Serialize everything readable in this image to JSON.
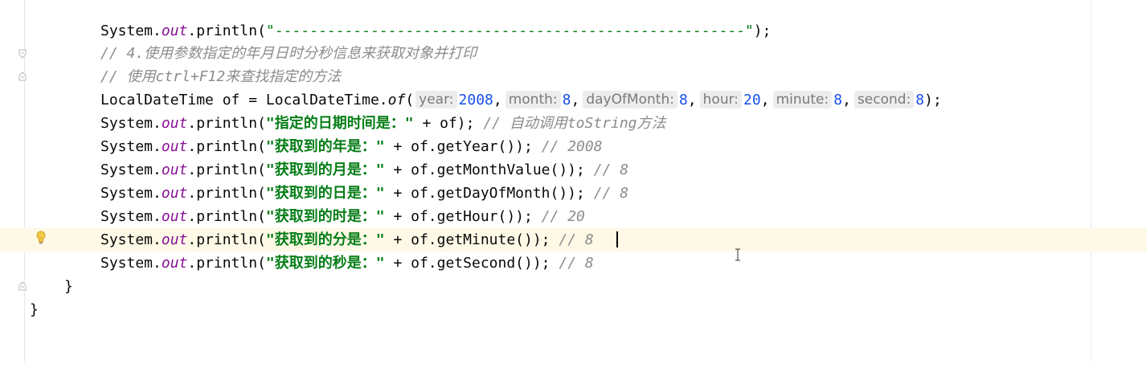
{
  "editor": {
    "lines": [
      {
        "id": "l1",
        "parts": [
          "System.",
          "out",
          ".println(",
          "\"------------------------------------------------------\"",
          ");"
        ]
      },
      {
        "id": "l2",
        "comment": "// 4.使用参数指定的年月日时分秒信息来获取对象并打印"
      },
      {
        "id": "l3",
        "comment": "// 使用ctrl+F12来查找指定的方法"
      },
      {
        "id": "l4",
        "prefix": "LocalDateTime of = LocalDateTime.",
        "method": "of",
        "open": "(",
        "params": [
          {
            "hint": "year:",
            "value": "2008"
          },
          {
            "hint": "month:",
            "value": "8"
          },
          {
            "hint": "dayOfMonth:",
            "value": "8"
          },
          {
            "hint": "hour:",
            "value": "20"
          },
          {
            "hint": "minute:",
            "value": "8"
          },
          {
            "hint": "second:",
            "value": "8"
          }
        ],
        "close": ");"
      },
      {
        "id": "l5",
        "str": "\"指定的日期时间是：\"",
        "rest": " + of); ",
        "comment": "// 自动调用toString方法"
      },
      {
        "id": "l6",
        "str": "\"获取到的年是：\"",
        "rest": " + of.getYear()); ",
        "comment": "// 2008"
      },
      {
        "id": "l7",
        "str": "\"获取到的月是：\"",
        "rest": " + of.getMonthValue()); ",
        "comment": "// 8"
      },
      {
        "id": "l8",
        "str": "\"获取到的日是：\"",
        "rest": " + of.getDayOfMonth()); ",
        "comment": "// 8"
      },
      {
        "id": "l9",
        "str": "\"获取到的时是：\"",
        "rest": " + of.getHour()); ",
        "comment": "// 20"
      },
      {
        "id": "l10",
        "str": "\"获取到的分是：\"",
        "rest": " + of.getMinute()); ",
        "comment": "// 8"
      },
      {
        "id": "l11",
        "str": "\"获取到的秒是：\"",
        "rest": " + of.getSecond()); ",
        "comment": "// 8"
      },
      {
        "id": "l12",
        "text": "}"
      },
      {
        "id": "l13",
        "text": "}"
      }
    ],
    "print_prefix": "System.",
    "print_field": "out",
    "print_method": ".println(",
    "icons": {
      "fold": "fold-marker-icon",
      "bulb": "lightbulb-intention-icon",
      "ibeam": "text-cursor-icon"
    },
    "colors": {
      "string": "#067d17",
      "comment": "#8c8c8c",
      "number": "#1750eb",
      "static_field": "#871094",
      "current_line": "#fdf9e6"
    }
  }
}
